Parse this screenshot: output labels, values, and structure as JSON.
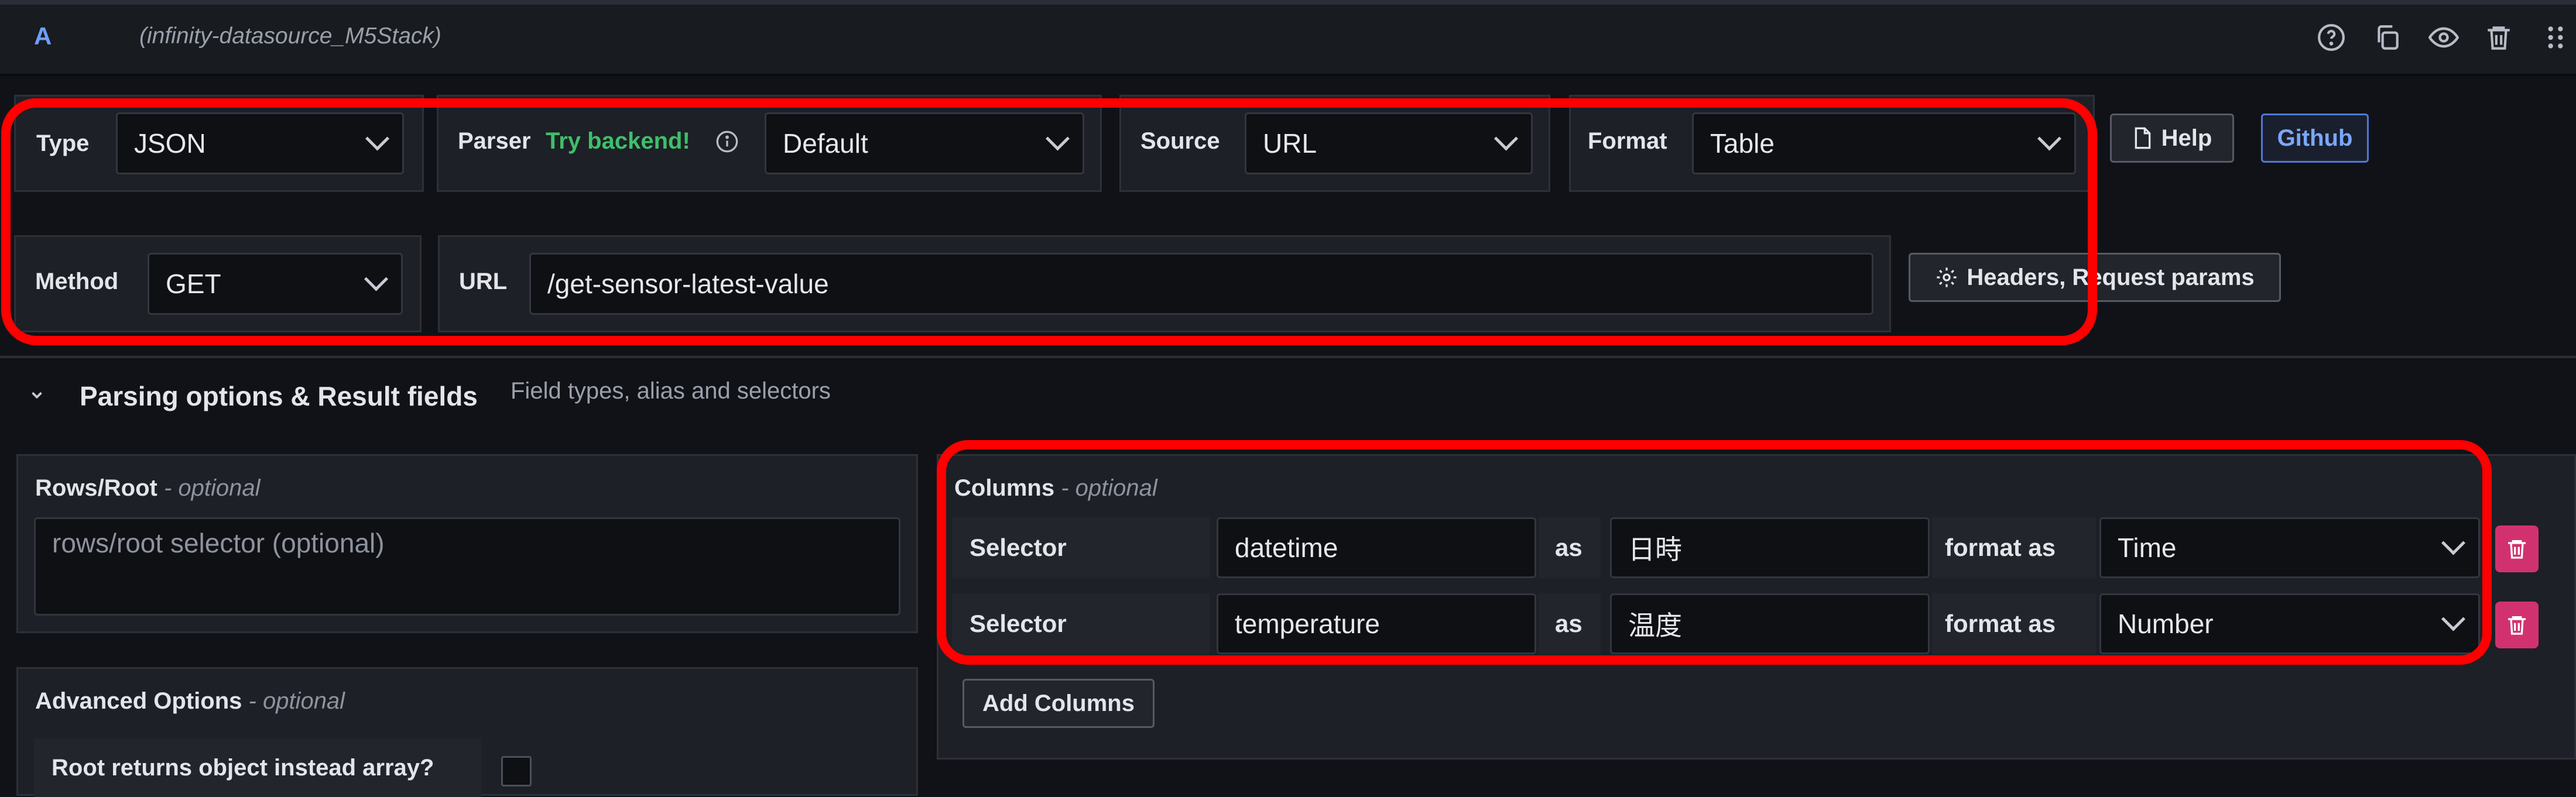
{
  "header": {
    "query_letter": "A",
    "datasource": "(infinity-datasource_M5Stack)"
  },
  "toolbar": {
    "type_label": "Type",
    "type_value": "JSON",
    "parser_label": "Parser",
    "parser_hint": "Try backend!",
    "parser_value": "Default",
    "source_label": "Source",
    "source_value": "URL",
    "format_label": "Format",
    "format_value": "Table",
    "help_label": "Help",
    "github_label": "Github"
  },
  "request": {
    "method_label": "Method",
    "method_value": "GET",
    "url_label": "URL",
    "url_value": "/get-sensor-latest-value",
    "headers_label": "Headers, Request params"
  },
  "parsing": {
    "title": "Parsing options & Result fields",
    "subtitle": "Field types, alias and selectors"
  },
  "rows_root": {
    "label": "Rows/Root",
    "optional": "- optional",
    "placeholder": "rows/root selector (optional)"
  },
  "advanced": {
    "label": "Advanced Options",
    "optional": "- optional",
    "root_object_label": "Root returns object instead array?"
  },
  "columns": {
    "label": "Columns",
    "optional": "- optional",
    "add_label": "Add Columns",
    "rows": [
      {
        "selector_label": "Selector",
        "selector": "datetime",
        "as_label": "as",
        "alias": "日時",
        "format_label": "format as",
        "format": "Time"
      },
      {
        "selector_label": "Selector",
        "selector": "temperature",
        "as_label": "as",
        "alias": "温度",
        "format_label": "format as",
        "format": "Number"
      }
    ]
  },
  "colors": {
    "accent_blue": "#6e9fff",
    "hint_green": "#3fbf6a",
    "delete_pink": "#d1326f",
    "highlight_red": "#ff0000"
  }
}
